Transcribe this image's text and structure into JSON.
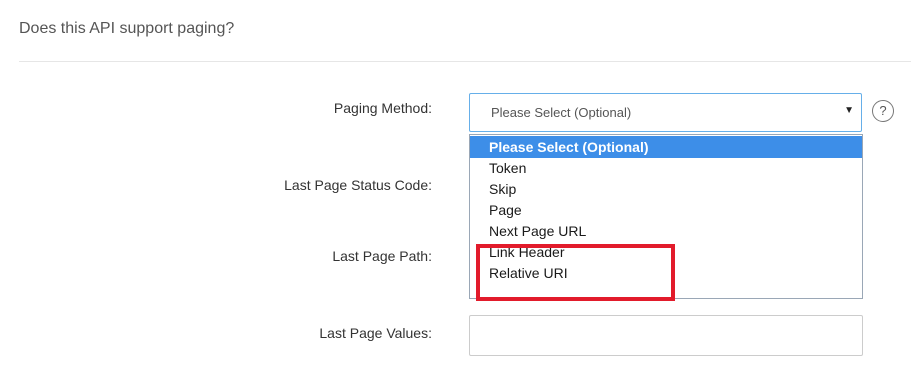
{
  "section": {
    "title": "Does this API support paging?"
  },
  "form": {
    "paging_method_label": "Paging Method:",
    "last_page_status_code_label": "Last Page Status Code:",
    "last_page_path_label": "Last Page Path:",
    "last_page_values_label": "Last Page Values:",
    "last_page_values_value": ""
  },
  "paging_select": {
    "selected_value": "Please Select (Optional)",
    "arrow_icon": "triangle-down-icon",
    "help_icon": "question-circle-icon",
    "help_glyph": "?",
    "options": [
      "Please Select (Optional)",
      "Token",
      "Skip",
      "Page",
      "Next Page URL",
      "Link Header",
      "Relative URI"
    ]
  },
  "colors": {
    "focus_border": "#66afe9",
    "selected_option_bg": "#3d8ee8",
    "highlight_box": "#e21b2b"
  }
}
